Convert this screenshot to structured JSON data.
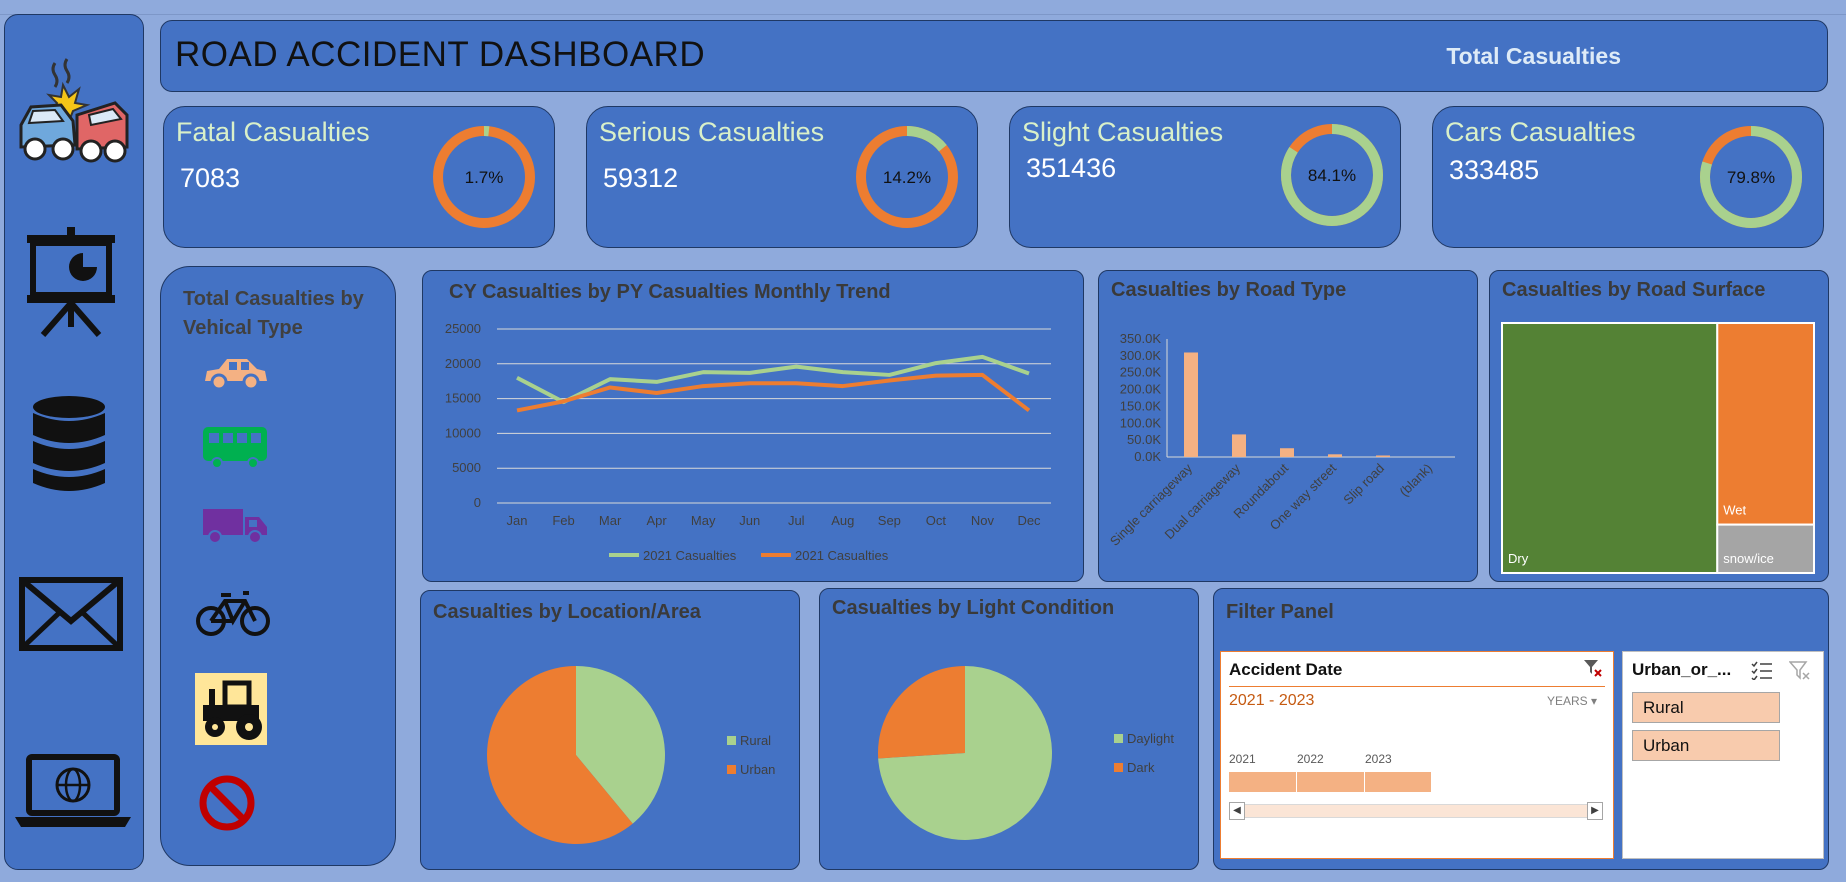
{
  "dashboard": {
    "title": "ROAD ACCIDENT DASHBOARD",
    "total_label": "Total Casualties"
  },
  "sidebar": {
    "icons": [
      {
        "name": "car-crash-icon"
      },
      {
        "name": "presentation-icon"
      },
      {
        "name": "database-icon"
      },
      {
        "name": "mail-icon"
      },
      {
        "name": "laptop-globe-icon"
      }
    ]
  },
  "kpis": [
    {
      "title": "Fatal Casualties",
      "value": "7083",
      "percent_label": "1.7%",
      "percent": 1.7
    },
    {
      "title": "Serious Casualties",
      "value": "59312",
      "percent_label": "14.2%",
      "percent": 14.2
    },
    {
      "title": "Slight Casualties",
      "value": "351436",
      "percent_label": "84.1%",
      "percent": 84.1
    },
    {
      "title": "Cars Casualties",
      "value": "333485",
      "percent_label": "79.8%",
      "percent": 79.8
    }
  ],
  "vehicle_panel": {
    "title": "Total Casualties by Vehical Type",
    "icons": [
      "car-icon",
      "bus-icon",
      "truck-icon",
      "bicycle-icon",
      "tractor-icon",
      "no-entry-icon"
    ]
  },
  "colors": {
    "green": "#a9d18e",
    "orange": "#ed7d31",
    "dark_green": "#548235",
    "grey": "#a5a5a5",
    "peach": "#f4b183",
    "panel": "#4472c4"
  },
  "chart_data": [
    {
      "id": "monthly_trend",
      "type": "line",
      "title": "CY Casualties by  PY Casualties Monthly Trend",
      "categories": [
        "Jan",
        "Feb",
        "Mar",
        "Apr",
        "May",
        "Jun",
        "Jul",
        "Aug",
        "Sep",
        "Oct",
        "Nov",
        "Dec"
      ],
      "ylim": [
        0,
        25000
      ],
      "yticks": [
        "0",
        "5000",
        "10000",
        "15000",
        "20000",
        "25000"
      ],
      "series": [
        {
          "name": "2021 Casualties",
          "color": "#a9d18e",
          "values": [
            18000,
            14500,
            17800,
            17400,
            18800,
            18700,
            19600,
            18800,
            18400,
            20100,
            21000,
            18600
          ]
        },
        {
          "name": "2021 Casualties",
          "color": "#ed7d31",
          "values": [
            13300,
            14600,
            16600,
            15800,
            16800,
            17200,
            17200,
            16800,
            17600,
            18300,
            18400,
            13300
          ]
        }
      ]
    },
    {
      "id": "road_type",
      "type": "bar",
      "title": "Casualties by  Road Type",
      "categories": [
        "Single carriageway",
        "Dual carriageway",
        "Roundabout",
        "One way street",
        "Slip road",
        "(blank)"
      ],
      "values": [
        310000,
        67000,
        26000,
        8000,
        4500,
        0
      ],
      "ylim": [
        0,
        350000
      ],
      "yticks": [
        "0.0K",
        "50.0K",
        "100.0K",
        "150.0K",
        "200.0K",
        "250.0K",
        "300.0K",
        "350.0K"
      ]
    },
    {
      "id": "road_surface",
      "type": "heatmap",
      "title": "Casualties by  Road Surface",
      "labels": [
        "Dry",
        "Wet",
        "snow/ice"
      ],
      "values": [
        69,
        25,
        6
      ]
    },
    {
      "id": "location_area",
      "type": "pie",
      "title": "Casualties by  Location/Area",
      "labels": [
        "Rural",
        "Urban"
      ],
      "values": [
        39,
        61
      ]
    },
    {
      "id": "light_condition",
      "type": "pie",
      "title": "Casualties by  Light Condition",
      "labels": [
        "Daylight",
        "Dark"
      ],
      "values": [
        74,
        26
      ]
    }
  ],
  "filter_panel": {
    "title": "Filter Panel",
    "date_slicer": {
      "title": "Accident Date",
      "range": "2021 - 2023",
      "unit": "YEARS",
      "years": [
        "2021",
        "2022",
        "2023"
      ]
    },
    "area_slicer": {
      "title": "Urban_or_...",
      "items": [
        "Rural",
        "Urban"
      ]
    }
  }
}
